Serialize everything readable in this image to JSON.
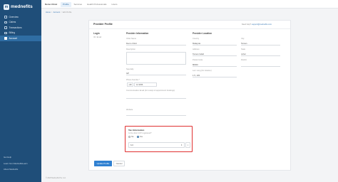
{
  "app": {
    "logo_text": "medneﬁts",
    "logo_mark": "m"
  },
  "sidebar": {
    "items": [
      {
        "label": "Overview",
        "icon": "grid-icon"
      },
      {
        "label": "Claims",
        "icon": "document-icon"
      },
      {
        "label": "Transactions",
        "icon": "swap-icon"
      },
      {
        "label": "Billing",
        "icon": "card-icon"
      },
      {
        "label": "Account",
        "icon": "user-icon",
        "active": true
      }
    ],
    "links": [
      "Get Help",
      "Learn from MedneﬁtsLearn",
      "About Medneﬁts"
    ]
  },
  "topbar": {
    "clinic": "Demo Clinic",
    "tabs": [
      "Profile",
      "Services",
      "Health Professionals",
      "Hours"
    ],
    "active_tab": "Profile"
  },
  "breadcrumb": [
    "Home",
    "Account",
    "Edit Profile"
  ],
  "card": {
    "title": "Provider Profile",
    "support_text": "Need help? ",
    "support_email": "support@medneﬁts.com",
    "login": {
      "title": "Login",
      "email_label": "ID / Email"
    },
    "provider_info": {
      "title": "Provider Information",
      "name_label": "Clinic Name",
      "name_value": "Demo Clinic",
      "desc_label": "Description",
      "specialty_label": "Specialty",
      "specialty_value": "GP",
      "phone_label": "Phone Number *",
      "phone_code": "+60",
      "phone_value": "12 3456",
      "comm_label": "Communication Email (for receipt of appointment bookings)",
      "website_label": "Website"
    },
    "provider_location": {
      "title": "Provider Location",
      "country_label": "Country",
      "country_value": "Malaysia",
      "city_label": "City",
      "city_value": "Taman",
      "address_label": "Address",
      "address_value": "Taman Indah",
      "state_label": "State",
      "state_value": "Johor",
      "postal_label": "Postal Code",
      "postal_value": "80000",
      "district_label": "District",
      "coords_label": "Lat / Long (for location)",
      "coords_value": "1.5, 103"
    },
    "tax": {
      "title": "Tax Information",
      "question": "Is the clinic GST registered?",
      "options": [
        "No",
        "Yes"
      ],
      "selected": "Yes",
      "rate_value": "6.0",
      "stepper": "⇕",
      "clear": "×"
    },
    "buttons": {
      "submit": "Update Profile",
      "cancel": "Cancel"
    }
  },
  "footer": {
    "text": "© 2023 Medneﬁts Pte. Ltd."
  }
}
